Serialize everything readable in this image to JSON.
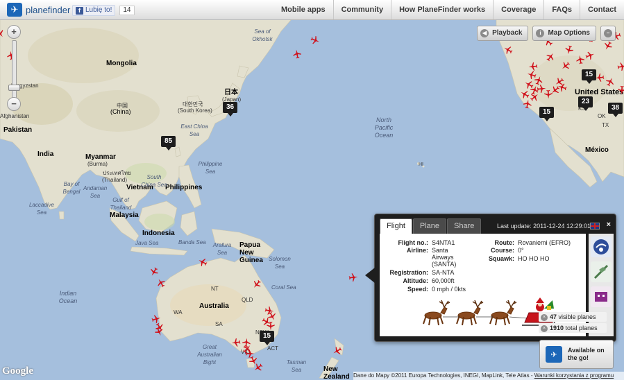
{
  "app": {
    "logo_text": "planefinder",
    "facebook_like_label": "Lubię to!",
    "facebook_like_count": "14"
  },
  "nav": {
    "items": [
      "Mobile apps",
      "Community",
      "How PlaneFinder works",
      "Coverage",
      "FAQs",
      "Contact"
    ]
  },
  "map_controls": {
    "zoom_in": "+",
    "zoom_out": "−",
    "playback_label": "Playback",
    "map_options_label": "Map Options"
  },
  "map_labels": {
    "mongolia": "Mongolia",
    "china_zh": "中国",
    "china": "(China)",
    "kyrgyzstan": "Kyrgyzstan",
    "afghanistan": "Afghanistan",
    "pakistan": "Pakistan",
    "india": "India",
    "myanmar": "Myanmar",
    "burma": "(Burma)",
    "thailand_th": "ประเทศไทย",
    "thailand": "(Thailand)",
    "vietnam": "Vietnam",
    "philippines": "Philippines",
    "malaysia": "Malaysia",
    "indonesia": "Indonesia",
    "korea_ko": "대한민국",
    "south_korea": "(South Korea)",
    "japan_ja": "日本",
    "japan": "(Japan)",
    "east_china_sea": "East China Sea",
    "south_china_sea": "South China Sea",
    "philippine_sea": "Philippine Sea",
    "sea_of_okhotsk": "Sea of Okhotsk",
    "bay_of_bengal": "Bay of Bengal",
    "andaman_sea": "Andaman Sea",
    "gulf_of_thailand": "Gulf of Thailand",
    "laccadive_sea": "Laccadive Sea",
    "java_sea": "Java Sea",
    "banda_sea": "Banda Sea",
    "arafura_sea": "Arafura Sea",
    "solomon_sea": "Solomon Sea",
    "coral_sea": "Coral Sea",
    "tasman_sea": "Tasman Sea",
    "great_australian_bight": "Great Australian Bight",
    "papua_new_guinea": "Papua New Guinea",
    "australia": "Australia",
    "new_zealand": "New Zealand",
    "north_pacific_ocean": "North Pacific Ocean",
    "indian_ocean": "Indian Ocean",
    "hi": "HI",
    "nt": "NT",
    "qld": "QLD",
    "wa": "WA",
    "sa": "SA",
    "nsw": "NSW",
    "act": "ACT",
    "vic": "VIC",
    "united_states": "United States",
    "mexico": "México",
    "ks": "KS",
    "ok": "OK",
    "tx": "TX"
  },
  "cluster_counts": [
    "85",
    "36",
    "15",
    "23",
    "15",
    "38",
    "15"
  ],
  "flight_panel": {
    "tabs": [
      "Flight",
      "Plane",
      "Share"
    ],
    "active_tab": "Flight",
    "last_update_label": "Last update:",
    "last_update_value": "2011-12-24 12:29:01",
    "close": "×",
    "fields": {
      "flight_no_label": "Flight no.:",
      "flight_no": "S4NTA1",
      "airline_label": "Airline:",
      "airline": "Santa Airways (SANTA)",
      "registration_label": "Registration:",
      "registration": "SA-NTA",
      "altitude_label": "Altitude:",
      "altitude": "60,000ft",
      "speed_label": "Speed:",
      "speed": "0 mph / 0kts",
      "route_label": "Route:",
      "route": "Rovaniemi (EFRO)",
      "course_label": "Course:",
      "course": "0°",
      "squawk_label": "Squawk:",
      "squawk": "HO HO HO"
    },
    "stats": {
      "visible_count": "47",
      "visible_label": "visible planes",
      "total_count": "1910",
      "total_label": "total planes"
    }
  },
  "mobile_badge": {
    "line1": "Available on",
    "line2": "the go!"
  },
  "footer": {
    "google": "Google",
    "attribution": "Dane do Mapy ©2011 Europa Technologies, INEGI, MapLink, Tele Atlas -",
    "terms": "Warunki korzystania z programu"
  },
  "colors": {
    "ocean": "#a5bfdd",
    "land": "#e3e0cf",
    "plane": "#d0101a",
    "panel_bg": "#1e1e1e",
    "brand": "#1d67b8"
  }
}
